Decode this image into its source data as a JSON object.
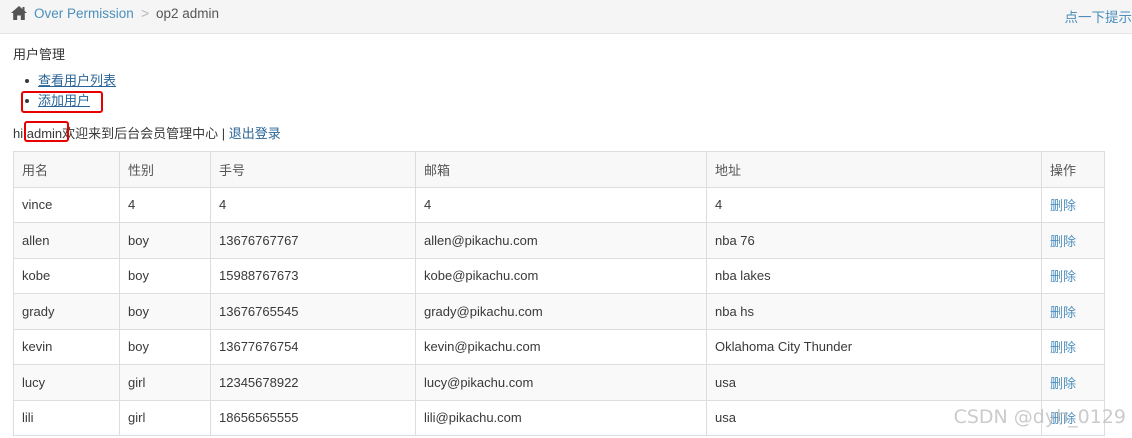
{
  "breadcrumb": {
    "home_icon": "home-icon",
    "parent": "Over Permission",
    "separator": ">",
    "current": "op2 admin"
  },
  "tip_link": "点一下提示",
  "section_title": "用户管理",
  "menu": [
    "查看用户列表",
    "添加用户"
  ],
  "greeting": {
    "prefix": "hi,",
    "username": "admin",
    "suffix": "欢迎来到后台会员管理中心 | ",
    "logout": "退出登录"
  },
  "table": {
    "headers": [
      "用名",
      "性别",
      "手号",
      "邮箱",
      "地址",
      "操作"
    ],
    "rows": [
      [
        "vince",
        "4",
        "4",
        "4",
        "4",
        "删除"
      ],
      [
        "allen",
        "boy",
        "13676767767",
        "allen@pikachu.com",
        "nba 76",
        "删除"
      ],
      [
        "kobe",
        "boy",
        "15988767673",
        "kobe@pikachu.com",
        "nba lakes",
        "删除"
      ],
      [
        "grady",
        "boy",
        "13676765545",
        "grady@pikachu.com",
        "nba hs",
        "删除"
      ],
      [
        "kevin",
        "boy",
        "13677676754",
        "kevin@pikachu.com",
        "Oklahoma City Thunder",
        "删除"
      ],
      [
        "lucy",
        "girl",
        "12345678922",
        "lucy@pikachu.com",
        "usa",
        "删除"
      ],
      [
        "lili",
        "girl",
        "18656565555",
        "lili@pikachu.com",
        "usa",
        "删除"
      ]
    ]
  },
  "watermark": "CSDN @dyh_0129",
  "colors": {
    "link": "#4c8fbd",
    "highlight_border": "#e60000",
    "topbar_bg": "#f5f5f5"
  }
}
